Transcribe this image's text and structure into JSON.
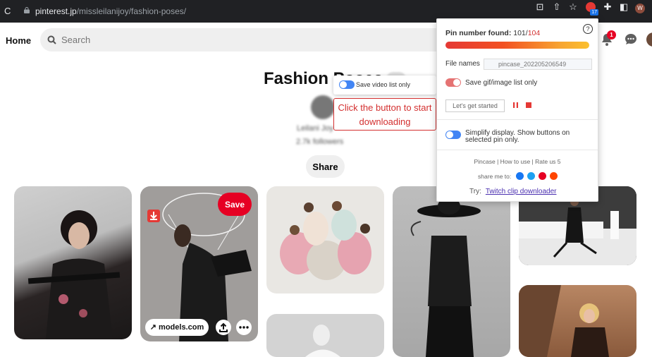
{
  "browser": {
    "url_domain": "pinterest.jp",
    "url_path": "/missleilanijoy/fashion-poses/",
    "extension_badge": "17",
    "profile_initial": "W"
  },
  "header": {
    "home_label": "Home",
    "search_placeholder": "Search",
    "notification_count": "1"
  },
  "board": {
    "title": "Fashion Poses",
    "owner_name": "Leilani Joy",
    "followers": "2.7k followers",
    "share_label": "Share"
  },
  "pins": {
    "save_label": "Save",
    "link_label": "models.com"
  },
  "popup": {
    "pin_number_label": "Pin number found:",
    "found": "101",
    "separator": "/",
    "total": "104",
    "progress": 0.97,
    "file_names_label": "File names",
    "file_names_placeholder": "pincase_202205206549",
    "save_gif_label": "Save gif/image list only",
    "start_button": "Let's get started",
    "simplify_label": "Simplify display. Show buttons on selected pin only.",
    "footer_links": [
      "Pincase",
      "How to use",
      "Rate us 5"
    ],
    "share_me_label": "share me to:",
    "try_label": "Try:",
    "try_link": "Twitch clip downloader"
  },
  "tooltips": {
    "save_video_label": "Save video list only",
    "click_hint": "Click the button to start downloading"
  },
  "colors": {
    "pinterest_red": "#e60023",
    "toggle_blue": "#4285f4",
    "toggle_red": "#e57373",
    "hint_red": "#d32f2f"
  }
}
